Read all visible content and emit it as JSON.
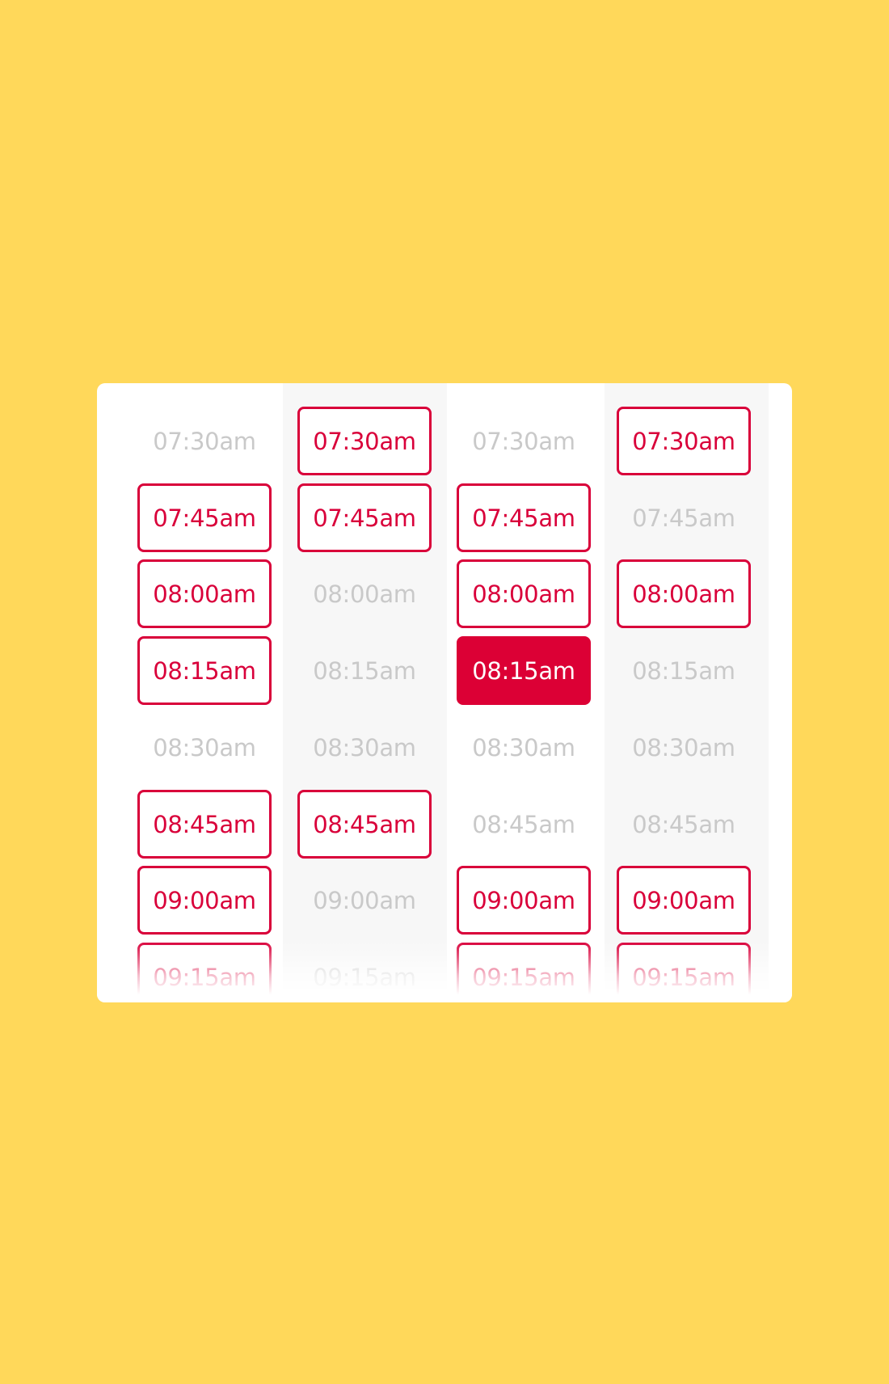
{
  "colors": {
    "background": "#FFD85A",
    "accent": "#D9003A",
    "selected_fill": "#DC0035",
    "unavailable_text": "#c9c9c9"
  },
  "columns": [
    {
      "slots": [
        {
          "time": "07:30am",
          "state": "unavailable"
        },
        {
          "time": "07:45am",
          "state": "available"
        },
        {
          "time": "08:00am",
          "state": "available"
        },
        {
          "time": "08:15am",
          "state": "available"
        },
        {
          "time": "08:30am",
          "state": "unavailable"
        },
        {
          "time": "08:45am",
          "state": "available"
        },
        {
          "time": "09:00am",
          "state": "available"
        },
        {
          "time": "09:15am",
          "state": "available"
        }
      ]
    },
    {
      "slots": [
        {
          "time": "07:30am",
          "state": "available"
        },
        {
          "time": "07:45am",
          "state": "available"
        },
        {
          "time": "08:00am",
          "state": "unavailable"
        },
        {
          "time": "08:15am",
          "state": "unavailable"
        },
        {
          "time": "08:30am",
          "state": "unavailable"
        },
        {
          "time": "08:45am",
          "state": "available"
        },
        {
          "time": "09:00am",
          "state": "unavailable"
        },
        {
          "time": "09:15am",
          "state": "unavailable"
        }
      ]
    },
    {
      "slots": [
        {
          "time": "07:30am",
          "state": "unavailable"
        },
        {
          "time": "07:45am",
          "state": "available"
        },
        {
          "time": "08:00am",
          "state": "available"
        },
        {
          "time": "08:15am",
          "state": "selected"
        },
        {
          "time": "08:30am",
          "state": "unavailable"
        },
        {
          "time": "08:45am",
          "state": "unavailable"
        },
        {
          "time": "09:00am",
          "state": "available"
        },
        {
          "time": "09:15am",
          "state": "available"
        }
      ]
    },
    {
      "slots": [
        {
          "time": "07:30am",
          "state": "available"
        },
        {
          "time": "07:45am",
          "state": "unavailable"
        },
        {
          "time": "08:00am",
          "state": "available"
        },
        {
          "time": "08:15am",
          "state": "unavailable"
        },
        {
          "time": "08:30am",
          "state": "unavailable"
        },
        {
          "time": "08:45am",
          "state": "unavailable"
        },
        {
          "time": "09:00am",
          "state": "available"
        },
        {
          "time": "09:15am",
          "state": "available"
        }
      ]
    }
  ]
}
